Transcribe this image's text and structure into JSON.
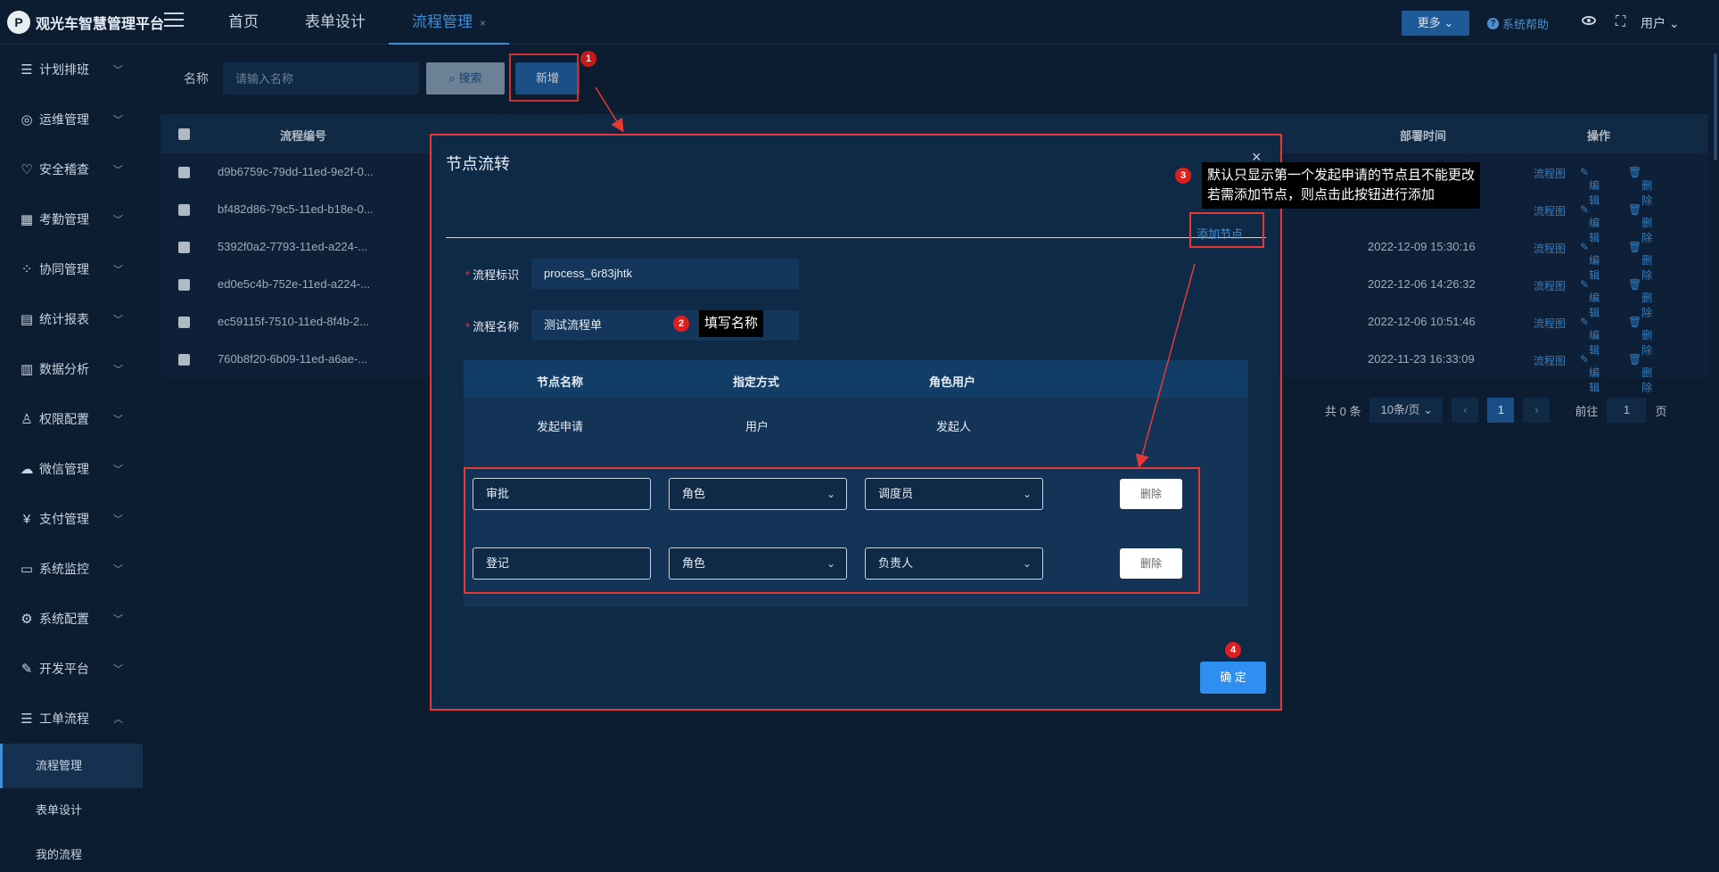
{
  "app": {
    "logo_glyph": "P",
    "title": "观光车智慧管理平台"
  },
  "nav": {
    "tabs": [
      {
        "label": "首页",
        "active": false
      },
      {
        "label": "表单设计",
        "active": false
      },
      {
        "label": "流程管理",
        "active": true
      }
    ],
    "more_label": "更多",
    "help_label": "系统帮助",
    "user_label": "用户"
  },
  "sidebar": {
    "items": [
      {
        "label": "计划排班",
        "icon": "list-icon"
      },
      {
        "label": "运维管理",
        "icon": "device-icon"
      },
      {
        "label": "安全稽查",
        "icon": "heart-icon"
      },
      {
        "label": "考勤管理",
        "icon": "calendar-icon"
      },
      {
        "label": "协同管理",
        "icon": "grid-icon"
      },
      {
        "label": "统计报表",
        "icon": "report-icon"
      },
      {
        "label": "数据分析",
        "icon": "bar-chart-icon"
      },
      {
        "label": "权限配置",
        "icon": "user-icon"
      },
      {
        "label": "微信管理",
        "icon": "wechat-icon"
      },
      {
        "label": "支付管理",
        "icon": "yen-icon"
      },
      {
        "label": "系统监控",
        "icon": "monitor-icon"
      },
      {
        "label": "系统配置",
        "icon": "gear-icon"
      },
      {
        "label": "开发平台",
        "icon": "edit-icon"
      },
      {
        "label": "工单流程",
        "icon": "list-icon"
      }
    ],
    "sub_items": [
      {
        "label": "流程管理",
        "active": true
      },
      {
        "label": "表单设计",
        "active": false
      },
      {
        "label": "我的流程",
        "active": false
      }
    ]
  },
  "search": {
    "label": "名称",
    "placeholder": "请输入名称",
    "search_button": "搜索",
    "add_button": "新增"
  },
  "table": {
    "columns": [
      "流程编号",
      "部署时间",
      "操作"
    ],
    "rows": [
      {
        "id": "d9b6759c-79dd-11ed-9e2f-0...",
        "time": ""
      },
      {
        "id": "bf482d86-79c5-11ed-b18e-0...",
        "time": ""
      },
      {
        "id": "5392f0a2-7793-11ed-a224-...",
        "time": "2022-12-09 15:30:16"
      },
      {
        "id": "ed0e5c4b-752e-11ed-a224-...",
        "time": "2022-12-06 14:26:32"
      },
      {
        "id": "ec59115f-7510-11ed-8f4b-2...",
        "time": "2022-12-06 10:51:46"
      },
      {
        "id": "760b8f20-6b09-11ed-a6ae-...",
        "time": "2022-11-23 16:33:09"
      }
    ],
    "ops": {
      "diagram": "流程图",
      "edit": "编辑",
      "delete": "删除"
    }
  },
  "pagination": {
    "total": "共 0 条",
    "page_size": "10条/页",
    "current_page": "1",
    "goto_label": "前往",
    "goto_value": "1",
    "page_unit": "页"
  },
  "modal": {
    "title": "节点流转",
    "close": "×",
    "add_node": "添加节点",
    "process_key_label": "流程标识",
    "process_key_value": "process_6r83jhtk",
    "process_name_label": "流程名称",
    "process_name_value": "测试流程单",
    "node_columns": [
      "节点名称",
      "指定方式",
      "角色用户"
    ],
    "fixed_node": {
      "name": "发起申请",
      "method": "用户",
      "user": "发起人"
    },
    "nodes": [
      {
        "name": "审批",
        "method": "角色",
        "role": "调度员",
        "delete": "删除"
      },
      {
        "name": "登记",
        "method": "角色",
        "role": "负责人",
        "delete": "删除"
      }
    ],
    "confirm": "确 定"
  },
  "annotations": {
    "badges": [
      "1",
      "2",
      "3",
      "4"
    ],
    "tip_name": "填写名称",
    "tip_add_line1": "默认只显示第一个发起申请的节点且不能更改",
    "tip_add_line2": "若需添加节点，则点击此按钮进行添加"
  },
  "colors": {
    "bg": "#0f2238",
    "accent": "#3f8fd6",
    "primary_button": "#1e5a98",
    "annotation_red": "#e53935"
  }
}
